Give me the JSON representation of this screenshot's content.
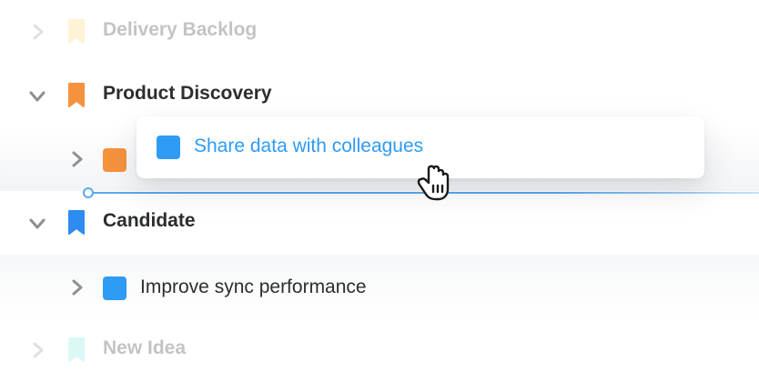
{
  "tree": {
    "groups": [
      {
        "label": "Delivery Backlog",
        "expanded": false,
        "faded": true,
        "color": "#ffd56a"
      },
      {
        "label": "Product Discovery",
        "expanded": true,
        "faded": false,
        "color": "#f5923e"
      },
      {
        "label": "Candidate",
        "expanded": true,
        "faded": false,
        "color": "#2e8cf0"
      },
      {
        "label": "New Idea",
        "expanded": false,
        "faded": true,
        "color": "#7de8e0"
      }
    ],
    "items": [
      {
        "label": "Improve sync performance",
        "color": "#2e9bf5"
      }
    ],
    "hidden_item": {
      "color": "#f5923e"
    }
  },
  "drag": {
    "label": "Share data with colleagues",
    "color": "#2e9bf5",
    "cursor": "grab-hand-icon"
  },
  "colors": {
    "text": "#2b2d31",
    "accent": "#2e9bf5",
    "chevron": "#8c9097"
  }
}
